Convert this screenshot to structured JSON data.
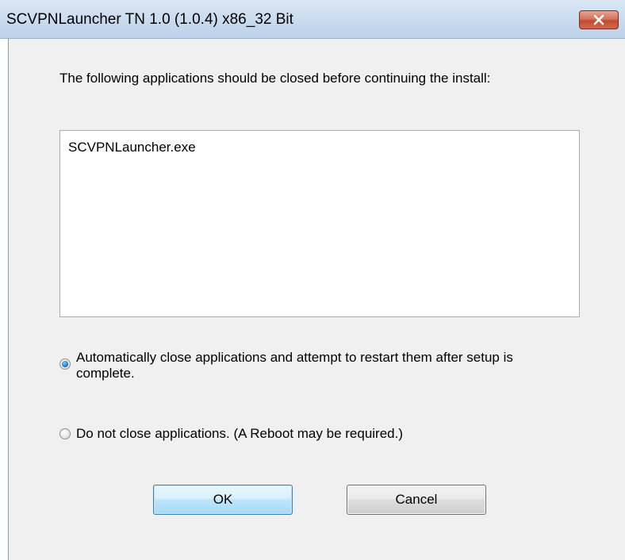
{
  "window": {
    "title": "SCVPNLauncher TN 1.0 (1.0.4) x86_32 Bit",
    "close_icon": "close-icon"
  },
  "dialog": {
    "prompt": "The following applications should be closed before continuing the install:",
    "applications": [
      "SCVPNLauncher.exe"
    ],
    "options": [
      {
        "label": "Automatically close applications and attempt to restart them after setup is complete.",
        "selected": true
      },
      {
        "label": "Do not close applications. (A Reboot may be required.)",
        "selected": false
      }
    ],
    "ok_label": "OK",
    "cancel_label": "Cancel"
  },
  "colors": {
    "titlebar": "#c9dbee",
    "client_background": "#f0f0f0",
    "close_button": "#c24a33",
    "default_button_border": "#3c7fb1"
  }
}
